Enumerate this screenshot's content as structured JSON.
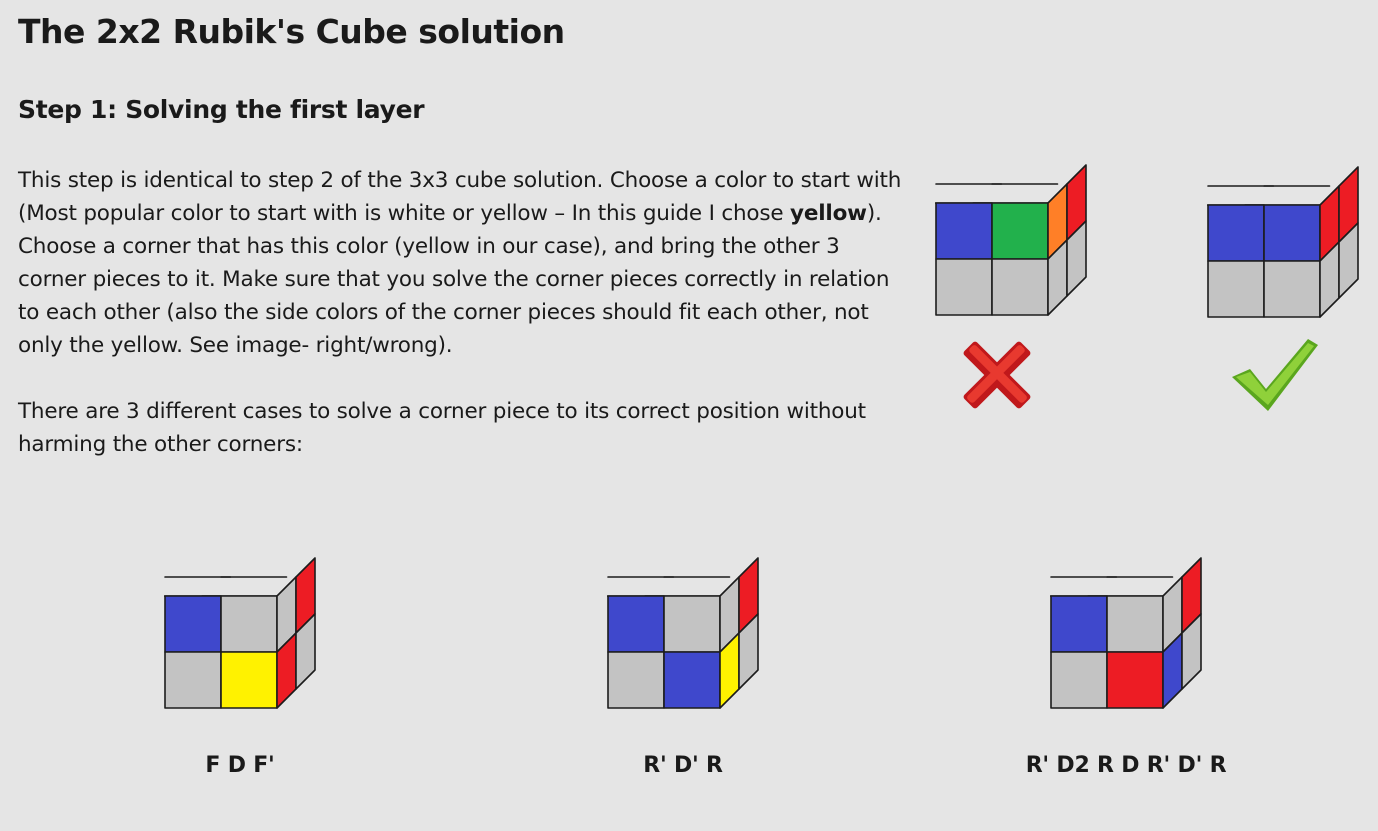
{
  "title": "The 2x2 Rubik's Cube solution",
  "step_heading": "Step 1: Solving the first layer",
  "paragraph1": {
    "before_bold": "This step is identical to step 2 of the 3x3 cube solution. Choose a color to start with (Most popular color to start with is white or yellow – In this guide I chose ",
    "bold": "yellow",
    "after_bold": "). Choose a corner that has this color (yellow in our case), and bring the other 3 corner pieces to it. Make sure that you solve the corner pieces correctly in relation to each other (also the side colors of the corner pieces should fit each other, not only the yellow. See image- right/wrong)."
  },
  "paragraph2": "There are 3 different cases to solve a corner piece to its correct position without harming the other corners:",
  "colors": {
    "yellow": "#fff200",
    "blue": "#3f48cc",
    "red": "#ed1c24",
    "green": "#22b14c",
    "orange": "#ff7f27",
    "gray": "#c3c3c3"
  },
  "comparison": {
    "wrong_icon": "cross-icon",
    "right_icon": "checkmark-icon"
  },
  "cases": [
    {
      "algorithm": "F D F'"
    },
    {
      "algorithm": "R' D' R"
    },
    {
      "algorithm": "R' D2 R D R' D' R"
    }
  ]
}
